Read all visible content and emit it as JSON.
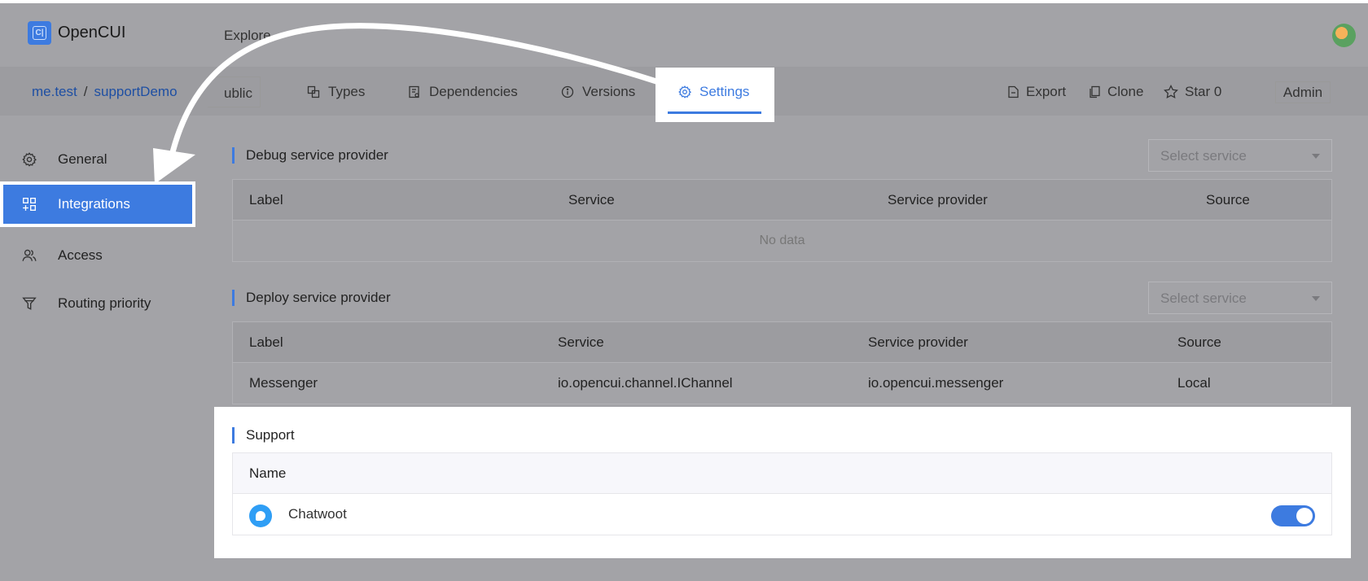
{
  "header": {
    "logo_text": "OpenCUI",
    "explore_label": "Explore"
  },
  "subnav": {
    "org": "me.test",
    "separator": "/",
    "project": "supportDemo",
    "visibility": "ublic",
    "tabs": [
      {
        "label": "Types",
        "icon": "types-icon"
      },
      {
        "label": "Dependencies",
        "icon": "dependencies-icon"
      },
      {
        "label": "Versions",
        "icon": "info-icon"
      },
      {
        "label": "Settings",
        "icon": "gear-icon",
        "active": true
      }
    ],
    "actions": {
      "export": "Export",
      "clone": "Clone",
      "star": "Star 0",
      "admin": "Admin"
    }
  },
  "sidebar": {
    "items": [
      {
        "label": "General",
        "icon": "gear-icon"
      },
      {
        "label": "Integrations",
        "icon": "integrations-icon",
        "active": true
      },
      {
        "label": "Access",
        "icon": "users-icon"
      },
      {
        "label": "Routing priority",
        "icon": "funnel-icon"
      }
    ]
  },
  "debug": {
    "title": "Debug service provider",
    "select_placeholder": "Select service",
    "columns": [
      "Label",
      "Service",
      "Service provider",
      "Source"
    ],
    "empty_text": "No data"
  },
  "deploy": {
    "title": "Deploy service provider",
    "select_placeholder": "Select service",
    "columns": [
      "Label",
      "Service",
      "Service provider",
      "Source"
    ],
    "rows": [
      {
        "label": "Messenger",
        "service": "io.opencui.channel.IChannel",
        "provider": "io.opencui.messenger",
        "source": "Local"
      }
    ]
  },
  "support": {
    "title": "Support",
    "column": "Name",
    "rows": [
      {
        "name": "Chatwoot",
        "icon": "chatwoot-icon",
        "enabled": true
      }
    ]
  },
  "colors": {
    "accent": "#3d7be0",
    "overlay": "#a3a3a7"
  }
}
